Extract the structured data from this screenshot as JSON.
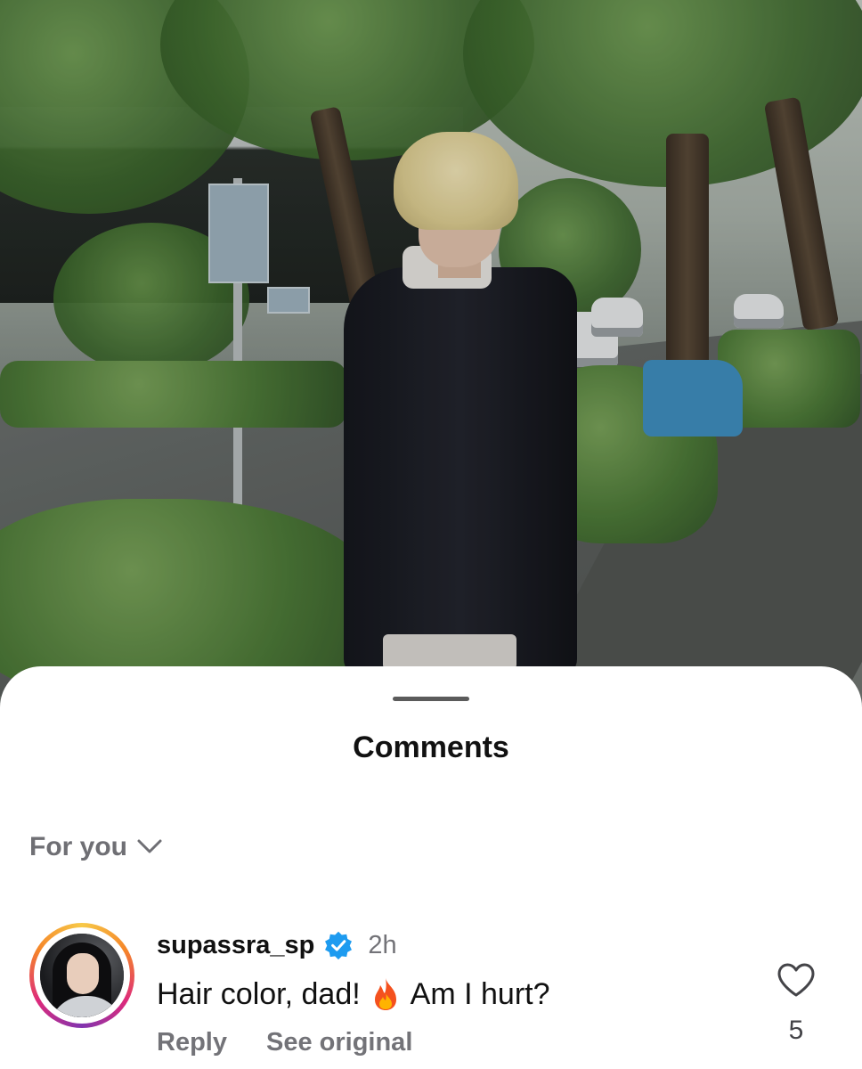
{
  "sheet": {
    "title": "Comments",
    "filter_label": "For you",
    "filter_icon": "chevron-down-icon"
  },
  "comment": {
    "username": "supassra_sp",
    "verified_icon": "verified-badge-icon",
    "timestamp": "2h",
    "text_before_emoji": "Hair color, dad!",
    "emoji_icon": "fire-icon",
    "text_after_emoji": "Am I hurt?",
    "reply_label": "Reply",
    "see_original_label": "See original",
    "like_icon": "heart-outline-icon",
    "like_count": "5"
  },
  "colors": {
    "verified_blue": "#1d9bf0",
    "muted_text": "#737378",
    "avatar_ring": [
      "#f7c948",
      "#f58529",
      "#dd2a7b",
      "#8134af"
    ]
  }
}
